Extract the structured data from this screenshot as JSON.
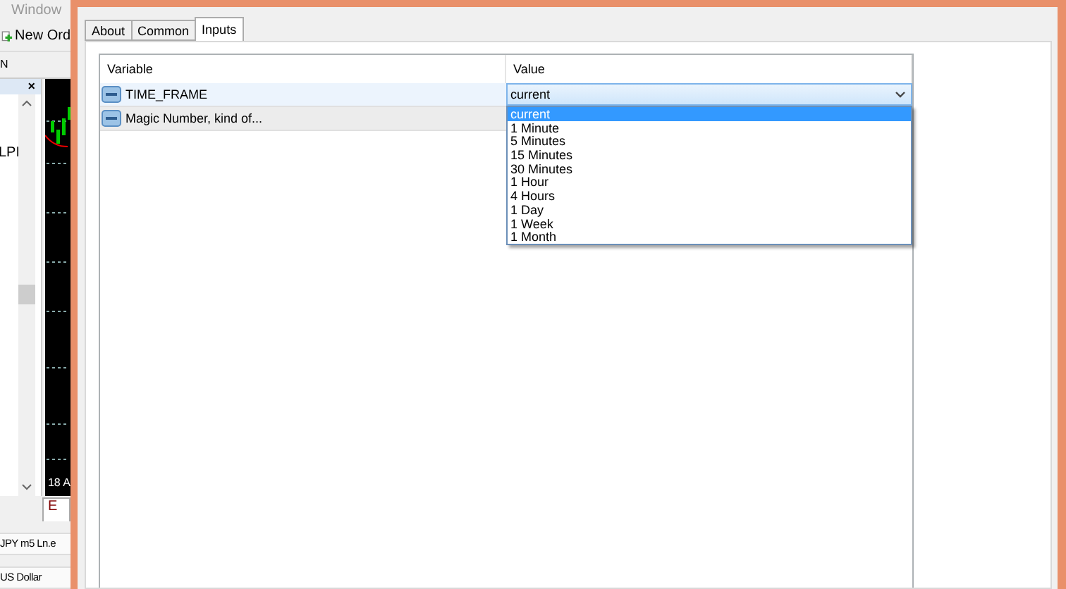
{
  "background_app": {
    "menu_item": "Window",
    "toolbar_button": "New Ord",
    "panel_tab": "N",
    "close_mark": "×",
    "panel_rows": [
      "LPI"
    ],
    "chart_label": "18 A",
    "bottom_tab": "E",
    "status_lines": [
      "JPY m5 Ln.e",
      "US Dollar"
    ]
  },
  "dialog": {
    "tabs": [
      {
        "label": "About",
        "selected": false
      },
      {
        "label": "Common",
        "selected": false
      },
      {
        "label": "Inputs",
        "selected": true
      }
    ],
    "table": {
      "columns": [
        "Variable",
        "Value"
      ],
      "rows": [
        {
          "variable": "TIME_FRAME",
          "value": "current",
          "selected": true
        },
        {
          "variable": "Magic Number, kind of...",
          "selected": false
        }
      ]
    },
    "dropdown": {
      "options": [
        {
          "label": "current",
          "selected": true
        },
        {
          "label": "1 Minute",
          "selected": false
        },
        {
          "label": "5 Minutes",
          "selected": false
        },
        {
          "label": "15 Minutes",
          "selected": false
        },
        {
          "label": "30 Minutes",
          "selected": false
        },
        {
          "label": "1 Hour",
          "selected": false
        },
        {
          "label": "4 Hours",
          "selected": false
        },
        {
          "label": "1 Day",
          "selected": false
        },
        {
          "label": "1 Week",
          "selected": false
        },
        {
          "label": "1 Month",
          "selected": false
        }
      ]
    }
  }
}
